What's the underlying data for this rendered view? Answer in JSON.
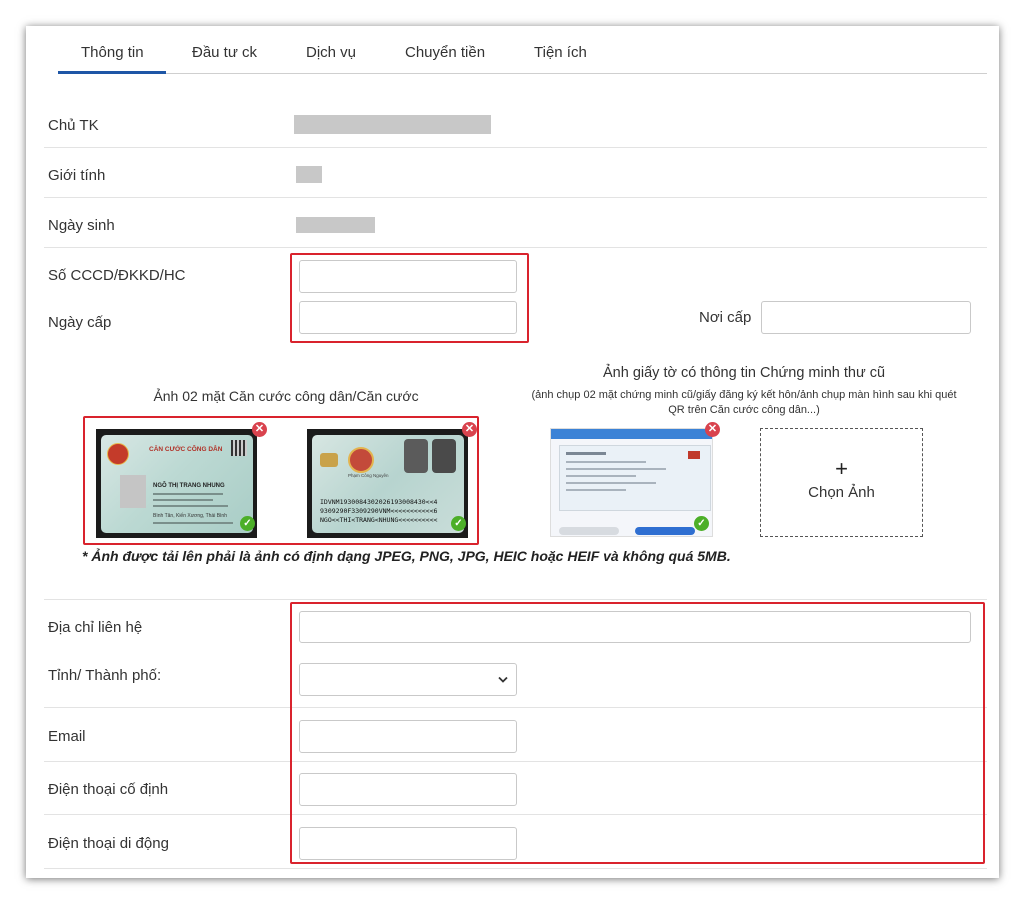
{
  "tabs": [
    "Thông tin",
    "Đầu tư ck",
    "Dịch vụ",
    "Chuyển tiền",
    "Tiện ích"
  ],
  "fields": {
    "account_holder": "Chủ TK",
    "gender": "Giới tính",
    "dob": "Ngày sinh",
    "id_number": "Số CCCD/ĐKKD/HC",
    "issue_date": "Ngày cấp",
    "issue_place": "Nơi cấp"
  },
  "uploads": {
    "id_caption": "Ảnh 02 mặt Căn cước công dân/Căn cước",
    "old_id_caption": "Ảnh giấy tờ có thông tin Chứng minh thư cũ",
    "old_id_subcaption": "(ảnh chụp 02 mặt chứng minh cũ/giấy đăng ký kết hôn/ảnh chụp màn hình sau khi quét QR trên Căn cước công dân...)",
    "choose_plus": "+",
    "choose_label": "Chọn Ảnh",
    "front_card": {
      "title": "CĂN CƯỚC CÔNG DÂN",
      "name": "NGÔ THỊ TRANG NHUNG",
      "address": "Bình Tân, Kiến Xương, Thái Bình"
    },
    "back_card": {
      "mrz1": "IDVNM1930084302026193008430<<4",
      "mrz2": "9309290F3309290VNM<<<<<<<<<<<6",
      "mrz3": "NGO<<THI<TRANG<NHUNG<<<<<<<<<<",
      "signer": "Phạm Công Nguyên"
    },
    "note": "* Ảnh được tải lên phải là ảnh có định dạng JPEG, PNG, JPG, HEIC hoặc HEIF và không quá 5MB."
  },
  "contact": {
    "address": "Địa chỉ liên hệ",
    "province": "Tỉnh/ Thành phố:",
    "email": "Email",
    "landline": "Điện thoại cố định",
    "mobile": "Điện thoại di động"
  },
  "colors": {
    "tab_active": "#1e56a6",
    "highlight": "#d9232d",
    "ok": "#4caf28",
    "remove": "#d9434e"
  },
  "icons": [
    "close-icon",
    "check-icon",
    "chevron-down-icon",
    "plus-icon"
  ]
}
